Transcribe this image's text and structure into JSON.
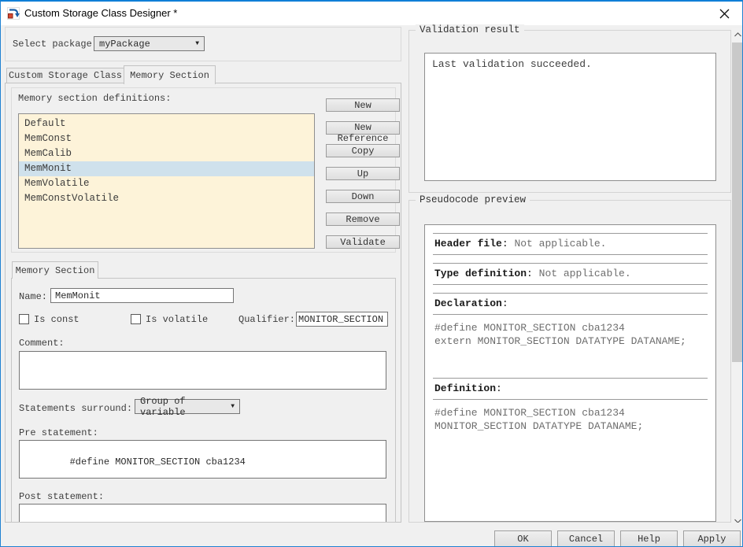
{
  "window": {
    "title": "Custom Storage Class Designer *"
  },
  "glyphs": {
    "dropdown_arrow": "▼"
  },
  "colors": {
    "accent_border": "#0f7fd7",
    "list_bg": "#fdf3d9",
    "selection_bg": "#cfe1ec"
  },
  "package_selector": {
    "label": "Select package:",
    "value": "myPackage"
  },
  "tabs": [
    {
      "label": "Custom Storage Class",
      "active": false
    },
    {
      "label": "Memory Section",
      "active": true
    }
  ],
  "memory_list": {
    "label": "Memory section definitions:",
    "items": [
      "Default",
      "MemConst",
      "MemCalib",
      "MemMonit",
      "MemVolatile",
      "MemConstVolatile"
    ],
    "selected": "MemMonit"
  },
  "list_buttons": [
    "New",
    "New Reference",
    "Copy",
    "Up",
    "Down",
    "Remove",
    "Validate"
  ],
  "section_panel": {
    "tab_label": "Memory Section",
    "name": {
      "label": "Name:",
      "value": "MemMonit"
    },
    "is_const": {
      "label": "Is const",
      "checked": false
    },
    "is_volatile": {
      "label": "Is volatile",
      "checked": false
    },
    "qualifier": {
      "label": "Qualifier:",
      "value": "MONITOR_SECTION"
    },
    "comment": {
      "label": "Comment:",
      "value": ""
    },
    "statements_surround": {
      "label": "Statements surround:",
      "value": "Group of variable"
    },
    "pre_statement": {
      "label": "Pre statement:",
      "value": "#define MONITOR_SECTION cba1234"
    },
    "post_statement": {
      "label": "Post statement:",
      "value": ""
    }
  },
  "validation": {
    "title": "Validation result",
    "message": "Last validation succeeded."
  },
  "pseudocode_preview": {
    "title": "Pseudocode preview",
    "sections": [
      {
        "label": "Header file",
        "value": "Not applicable.",
        "code": []
      },
      {
        "label": "Type definition",
        "value": "Not applicable.",
        "code": []
      },
      {
        "label": "Declaration",
        "value": "",
        "code": [
          "#define MONITOR_SECTION cba1234",
          "extern MONITOR_SECTION DATATYPE DATANAME;"
        ]
      },
      {
        "label": "Definition",
        "value": "",
        "code": [
          "#define MONITOR_SECTION cba1234",
          "MONITOR_SECTION DATATYPE DATANAME;"
        ]
      }
    ]
  },
  "footer_buttons": [
    "OK",
    "Cancel",
    "Help",
    "Apply"
  ]
}
